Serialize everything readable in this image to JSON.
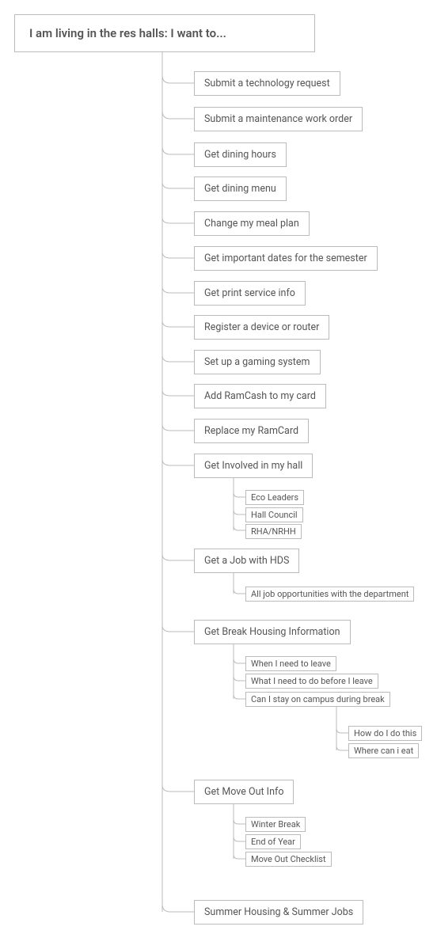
{
  "root": {
    "title": "I am living in the res halls: I want to..."
  },
  "items": [
    {
      "label": "Submit a technology request"
    },
    {
      "label": "Submit a maintenance work order"
    },
    {
      "label": "Get dining hours"
    },
    {
      "label": "Get dining menu"
    },
    {
      "label": "Change my meal plan"
    },
    {
      "label": "Get important dates for the semester"
    },
    {
      "label": "Get print service info"
    },
    {
      "label": "Register a device or router"
    },
    {
      "label": "Set up a gaming system"
    },
    {
      "label": "Add RamCash to my card"
    },
    {
      "label": "Replace my RamCard"
    },
    {
      "label": "Get Involved in my hall",
      "children": [
        {
          "label": "Eco Leaders"
        },
        {
          "label": "Hall Council"
        },
        {
          "label": "RHA/NRHH"
        }
      ]
    },
    {
      "label": "Get a Job with HDS",
      "children": [
        {
          "label": "All job opportunities with the department"
        }
      ]
    },
    {
      "label": "Get Break Housing Information",
      "children": [
        {
          "label": "When I need to leave"
        },
        {
          "label": "What I need to do before I leave"
        },
        {
          "label": "Can I stay on campus during break",
          "children": [
            {
              "label": "How do I do this"
            },
            {
              "label": "Where can i eat"
            }
          ]
        }
      ]
    },
    {
      "label": "Get Move Out Info",
      "children": [
        {
          "label": "Winter Break"
        },
        {
          "label": "End of Year"
        },
        {
          "label": "Move Out Checklist"
        }
      ]
    },
    {
      "label": "Summer Housing & Summer Jobs"
    }
  ]
}
